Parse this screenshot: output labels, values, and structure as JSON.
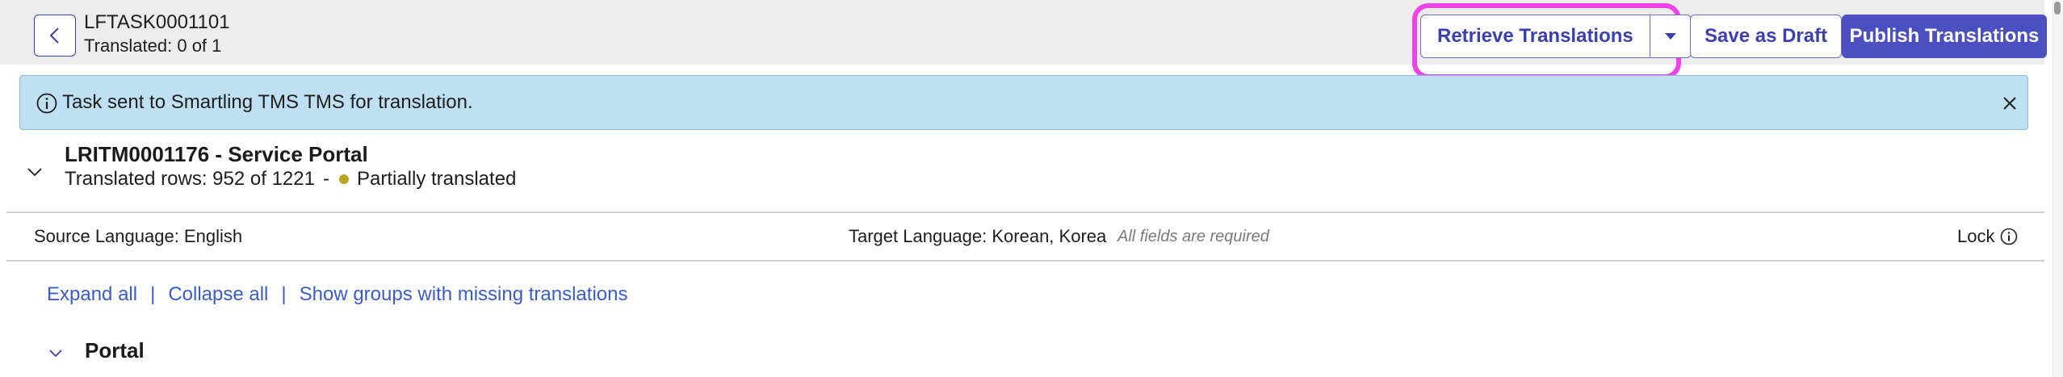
{
  "header": {
    "task_id": "LFTASK0001101",
    "translated_status": "Translated: 0 of 1"
  },
  "actions": {
    "retrieve_label": "Retrieve Translations",
    "save_draft_label": "Save as Draft",
    "publish_label": "Publish Translations"
  },
  "banner": {
    "message": "Task sent to Smartling TMS TMS for translation."
  },
  "item": {
    "title": "LRITM0001176 - Service Portal",
    "rows_text": "Translated rows: 952 of 1221",
    "separator": "-",
    "status_text": "Partially translated",
    "status_color": "#b8a424"
  },
  "languages": {
    "source": "Source Language: English",
    "target": "Target Language: Korean, Korea",
    "required_note": "All fields are required",
    "lock_label": "Lock"
  },
  "links": {
    "expand_all": "Expand all",
    "separator": "|",
    "collapse_all": "Collapse all",
    "show_missing": "Show groups with missing translations"
  },
  "group": {
    "title": "Portal"
  },
  "icons": {
    "back": "chevron-left-icon",
    "caret": "caret-down-icon",
    "info": "info-icon",
    "close": "close-icon",
    "expand": "chevron-down-icon"
  },
  "colors": {
    "accent": "#4c4fbf",
    "highlight": "#ee43e8",
    "banner_bg": "#bfe0f2",
    "link": "#3a5cc8"
  }
}
